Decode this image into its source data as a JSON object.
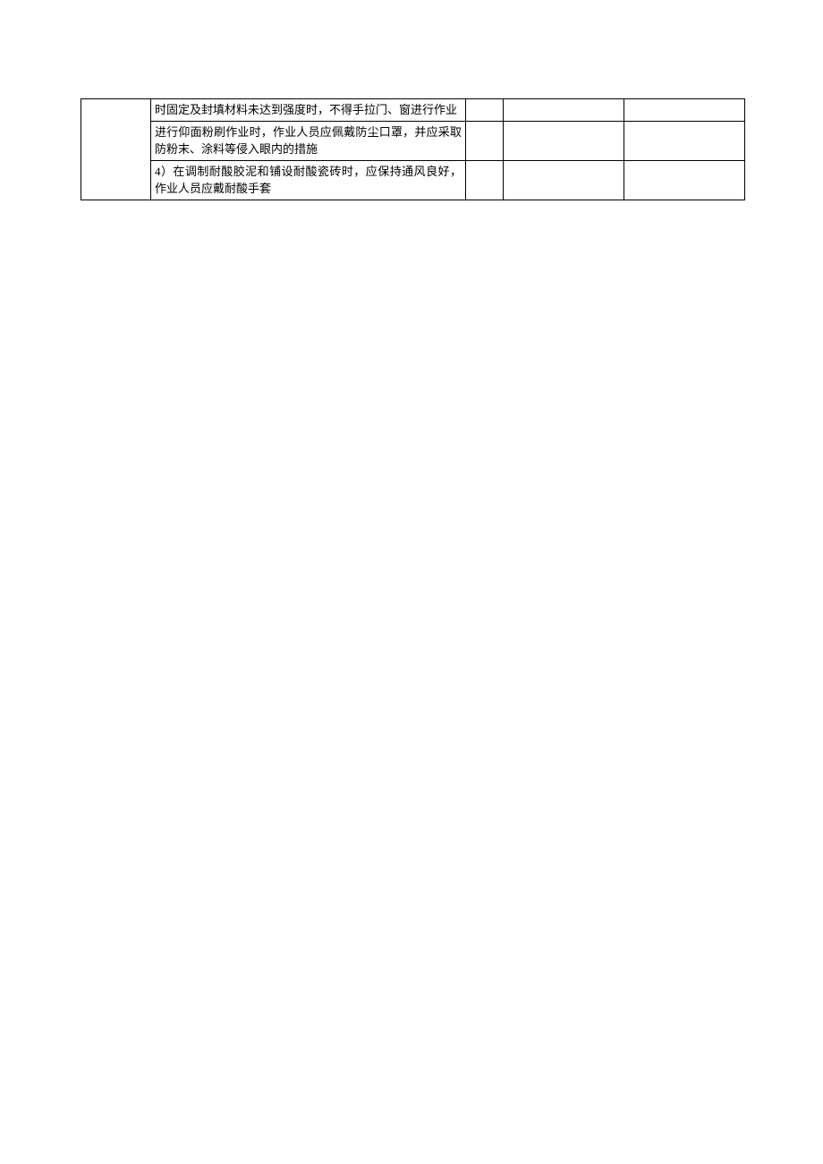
{
  "table": {
    "rows": [
      {
        "col2": "时固定及封填材料未达到强度时，不得手拉门、窗进行作业"
      },
      {
        "col2": "进行仰面粉刷作业时，作业人员应佩戴防尘口罩，并应采取防粉末、涂料等侵入眼内的措施"
      },
      {
        "col2": "4）在调制耐酸胶泥和铺设耐酸瓷砖时，应保持通风良好，作业人员应戴耐酸手套"
      }
    ]
  }
}
